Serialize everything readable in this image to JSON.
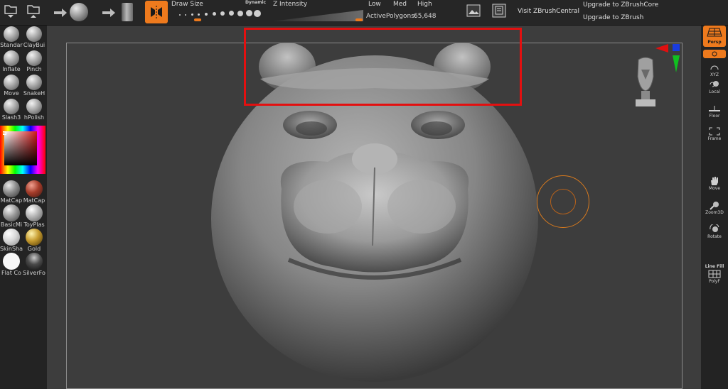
{
  "toolbar": {
    "draw_size_label": "Draw Size",
    "dynamic_label": "Dynamic",
    "z_intensity_label": "Z Intensity",
    "low_label": "Low",
    "med_label": "Med",
    "high_label": "High",
    "active_polygons_label": "ActivePolygons:",
    "active_polygons_value": "65,648",
    "visit_label": "Visit ZBrushCentral",
    "upgrade_core_label": "Upgrade to ZBrushCore",
    "upgrade_label": "Upgrade to ZBrush",
    "icons": [
      "open-icon",
      "save-icon",
      "arrow-right-icon",
      "sphere-tool-icon",
      "arrow-right-icon",
      "cylinder-tool-icon",
      "symmetry-icon",
      "image-icon",
      "document-icon"
    ],
    "accent_color": "#ee7a1d"
  },
  "left_shelf": {
    "brushes": [
      "Standar",
      "ClayBui",
      "Inflate",
      "Pinch",
      "Move",
      "SnakeH",
      "Slash3",
      "hPolish"
    ],
    "materials": [
      "MatCap",
      "MatCap",
      "BasicMi",
      "ToyPlas",
      "SkinSha",
      "Gold",
      "Flat Co",
      "SilverFo"
    ]
  },
  "right_shelf": {
    "items": [
      "Persp",
      "XYZ",
      "Local",
      "Floor",
      "Frame",
      "Move",
      "Zoom3D",
      "Rotate",
      "Line Fill",
      "PolyF"
    ]
  },
  "canvas": {
    "highlight_color": "#e31010",
    "model": "sculpted-head-icon"
  }
}
